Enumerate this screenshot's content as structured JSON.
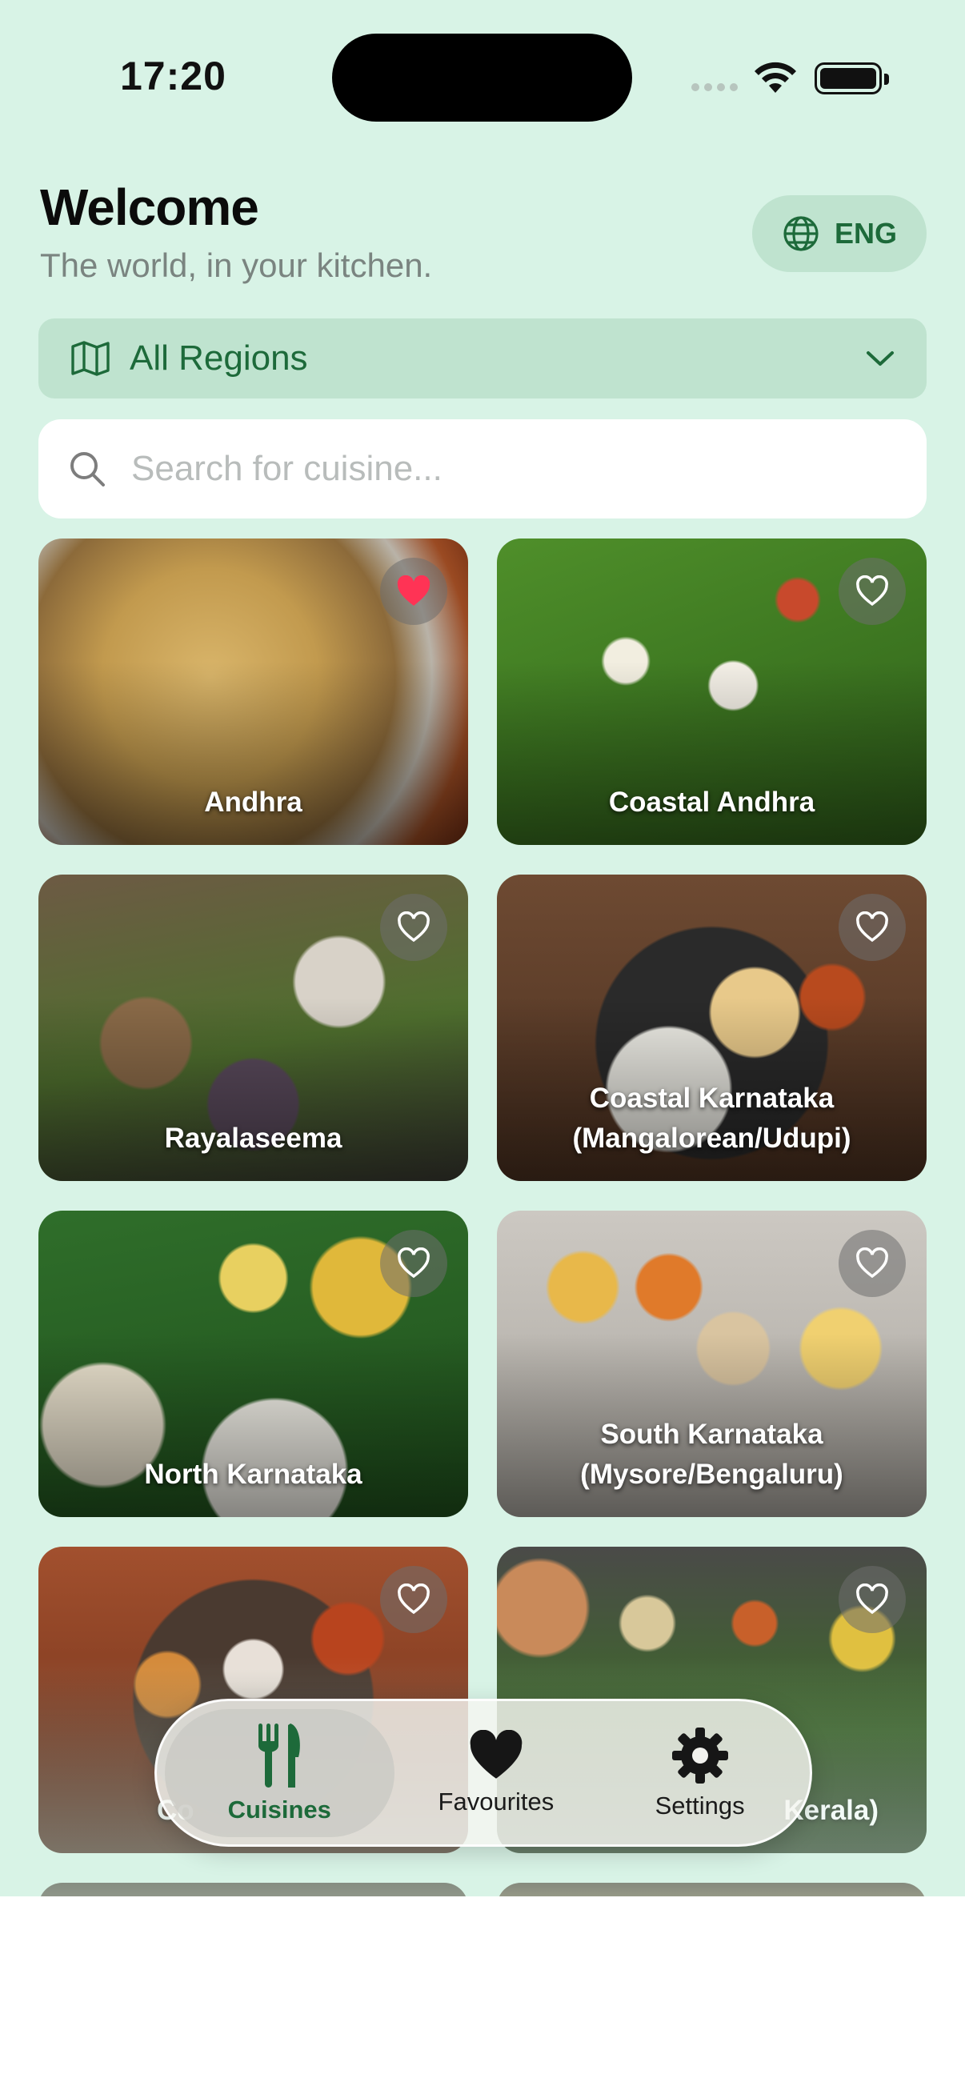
{
  "status": {
    "time": "17:20"
  },
  "header": {
    "title": "Welcome",
    "subtitle": "The world, in your kitchen.",
    "language_label": "ENG"
  },
  "region_filter": {
    "selected": "All Regions"
  },
  "search": {
    "placeholder": "Search for cuisine...",
    "value": ""
  },
  "colors": {
    "accent": "#1d6a3a",
    "background": "#d8f3e6",
    "chip": "#bfe3cf",
    "favorite_active": "#ff3355"
  },
  "cuisines": [
    {
      "name": "Andhra",
      "favorite": true
    },
    {
      "name": "Coastal Andhra",
      "favorite": false
    },
    {
      "name": "Rayalaseema",
      "favorite": false
    },
    {
      "name": "Coastal Karnataka\n(Mangalorean/Udupi)",
      "favorite": false
    },
    {
      "name": "North Karnataka",
      "favorite": false
    },
    {
      "name": "South Karnataka\n(Mysore/Bengaluru)",
      "favorite": false
    },
    {
      "name": "Co",
      "favorite": false
    },
    {
      "name": "Kerala)",
      "favorite": false
    }
  ],
  "tabbar": {
    "items": [
      {
        "label": "Cuisines",
        "icon": "fork-knife-icon",
        "active": true
      },
      {
        "label": "Favourites",
        "icon": "heart-icon",
        "active": false
      },
      {
        "label": "Settings",
        "icon": "gear-icon",
        "active": false
      }
    ]
  }
}
